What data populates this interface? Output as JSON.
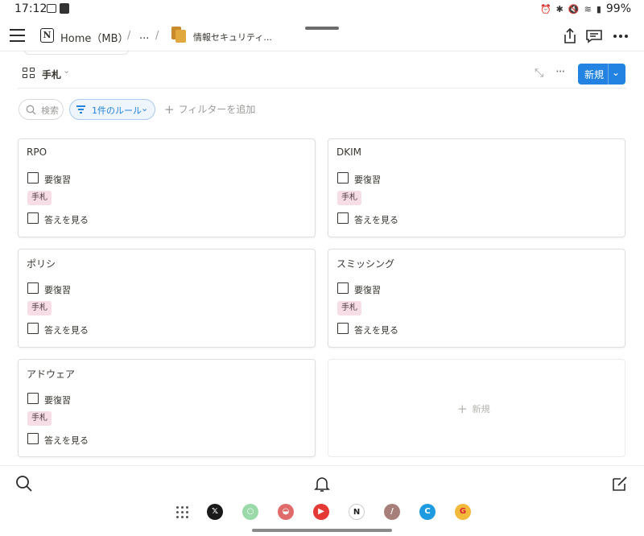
{
  "status_bar": {
    "time": "17:12",
    "battery": "99%"
  },
  "breadcrumb": {
    "home": "Home（MB）",
    "sep1": "/",
    "ellipsis": "...",
    "sep2": "/",
    "page": "情報セキュリティ..."
  },
  "view": {
    "label": "手札",
    "new_label": "新規"
  },
  "filters": {
    "search_placeholder": "検索",
    "rule_label": "1件のルール",
    "add_filter": "フィルターを追加"
  },
  "cards": [
    {
      "title": "RPO",
      "review_label": "要復習",
      "tag": "手札",
      "answer_label": "答えを見る"
    },
    {
      "title": "DKIM",
      "review_label": "要復習",
      "tag": "手札",
      "answer_label": "答えを見る"
    },
    {
      "title": "ポリシ",
      "review_label": "要復習",
      "tag": "手札",
      "answer_label": "答えを見る"
    },
    {
      "title": "スミッシング",
      "review_label": "要復習",
      "tag": "手札",
      "answer_label": "答えを見る"
    },
    {
      "title": "アドウェア",
      "review_label": "要復習",
      "tag": "手札",
      "answer_label": "答えを見る"
    }
  ],
  "new_card_label": "新規",
  "colors": {
    "accent": "#2383e2",
    "tag_bg": "#f6dde6",
    "filter_bg": "#eef5fc"
  },
  "icons": {
    "menu": "hamburger-icon",
    "notion": "notion-logo-icon",
    "share": "share-icon",
    "comments": "comment-icon",
    "more": "more-icon",
    "search": "search-icon",
    "bell": "bell-icon",
    "compose": "compose-icon"
  },
  "dock": [
    "X",
    "LINE",
    "app",
    "YouTube",
    "Notion",
    "pen",
    "C",
    "browser"
  ]
}
